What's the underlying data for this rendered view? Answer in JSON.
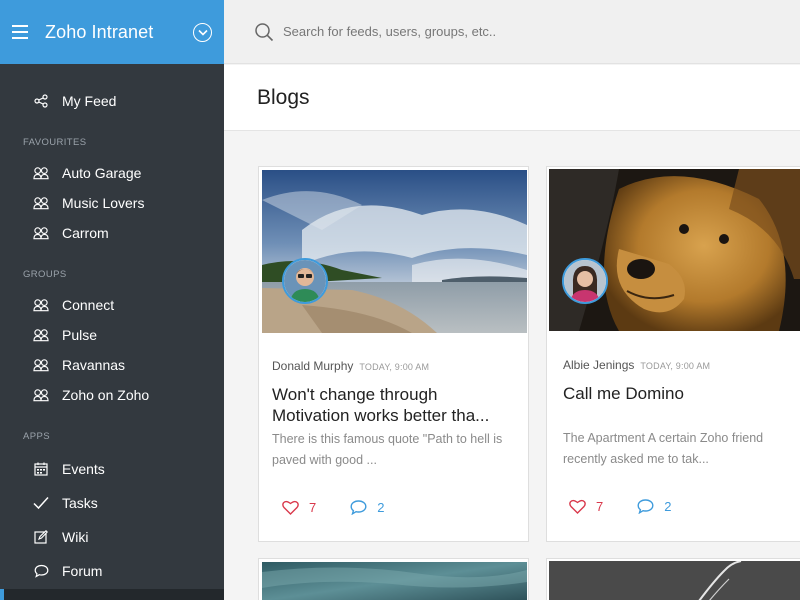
{
  "app": {
    "title": "Zoho Intranet"
  },
  "search": {
    "placeholder": "Search for feeds, users, groups, etc.."
  },
  "sidebar": {
    "my_feed": "My Feed",
    "favourites_label": "FAVOURITES",
    "favourites": [
      "Auto Garage",
      "Music Lovers",
      "Carrom"
    ],
    "groups_label": "GROUPS",
    "groups": [
      "Connect",
      "Pulse",
      "Ravannas",
      "Zoho on Zoho"
    ],
    "apps_label": "APPS",
    "apps": [
      {
        "label": "Events",
        "icon": "calendar-icon"
      },
      {
        "label": "Tasks",
        "icon": "check-icon"
      },
      {
        "label": "Wiki",
        "icon": "edit-icon"
      },
      {
        "label": "Forum",
        "icon": "chat-icon"
      }
    ]
  },
  "page": {
    "title": "Blogs"
  },
  "posts": [
    {
      "author": "Donald Murphy",
      "time": "TODAY, 9:00 AM",
      "title": "Won't change through Motivation works better tha...",
      "excerpt": "There is this famous quote \"Path to hell is paved with good ...",
      "likes": "7",
      "comments": "2"
    },
    {
      "author": "Albie Jenings",
      "time": "TODAY, 9:00 AM",
      "title": "Call me Domino",
      "excerpt": "The Apartment A certain Zoho friend recently asked me to tak...",
      "likes": "7",
      "comments": "2"
    }
  ],
  "colors": {
    "brand": "#3e9bdc",
    "sidebar": "#33393f",
    "like": "#d9384b"
  }
}
